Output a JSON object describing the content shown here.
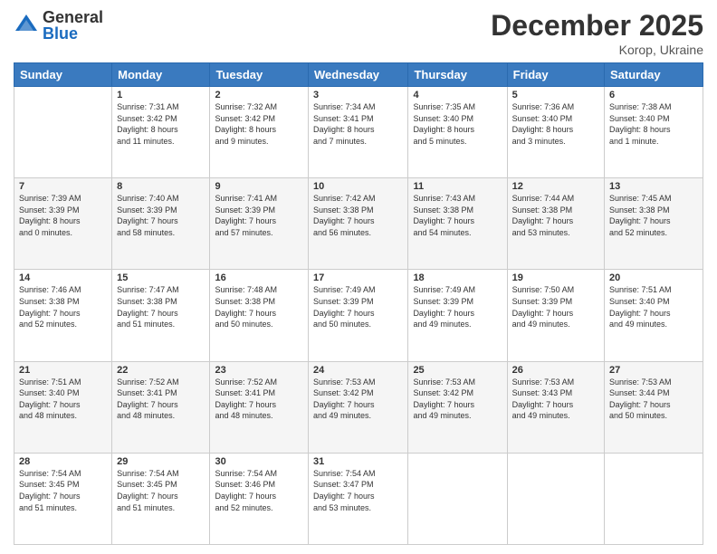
{
  "header": {
    "logo_general": "General",
    "logo_blue": "Blue",
    "month_title": "December 2025",
    "location": "Korop, Ukraine"
  },
  "days_of_week": [
    "Sunday",
    "Monday",
    "Tuesday",
    "Wednesday",
    "Thursday",
    "Friday",
    "Saturday"
  ],
  "weeks": [
    [
      {
        "day": "",
        "info": ""
      },
      {
        "day": "1",
        "info": "Sunrise: 7:31 AM\nSunset: 3:42 PM\nDaylight: 8 hours\nand 11 minutes."
      },
      {
        "day": "2",
        "info": "Sunrise: 7:32 AM\nSunset: 3:42 PM\nDaylight: 8 hours\nand 9 minutes."
      },
      {
        "day": "3",
        "info": "Sunrise: 7:34 AM\nSunset: 3:41 PM\nDaylight: 8 hours\nand 7 minutes."
      },
      {
        "day": "4",
        "info": "Sunrise: 7:35 AM\nSunset: 3:40 PM\nDaylight: 8 hours\nand 5 minutes."
      },
      {
        "day": "5",
        "info": "Sunrise: 7:36 AM\nSunset: 3:40 PM\nDaylight: 8 hours\nand 3 minutes."
      },
      {
        "day": "6",
        "info": "Sunrise: 7:38 AM\nSunset: 3:40 PM\nDaylight: 8 hours\nand 1 minute."
      }
    ],
    [
      {
        "day": "7",
        "info": "Sunrise: 7:39 AM\nSunset: 3:39 PM\nDaylight: 8 hours\nand 0 minutes."
      },
      {
        "day": "8",
        "info": "Sunrise: 7:40 AM\nSunset: 3:39 PM\nDaylight: 7 hours\nand 58 minutes."
      },
      {
        "day": "9",
        "info": "Sunrise: 7:41 AM\nSunset: 3:39 PM\nDaylight: 7 hours\nand 57 minutes."
      },
      {
        "day": "10",
        "info": "Sunrise: 7:42 AM\nSunset: 3:38 PM\nDaylight: 7 hours\nand 56 minutes."
      },
      {
        "day": "11",
        "info": "Sunrise: 7:43 AM\nSunset: 3:38 PM\nDaylight: 7 hours\nand 54 minutes."
      },
      {
        "day": "12",
        "info": "Sunrise: 7:44 AM\nSunset: 3:38 PM\nDaylight: 7 hours\nand 53 minutes."
      },
      {
        "day": "13",
        "info": "Sunrise: 7:45 AM\nSunset: 3:38 PM\nDaylight: 7 hours\nand 52 minutes."
      }
    ],
    [
      {
        "day": "14",
        "info": "Sunrise: 7:46 AM\nSunset: 3:38 PM\nDaylight: 7 hours\nand 52 minutes."
      },
      {
        "day": "15",
        "info": "Sunrise: 7:47 AM\nSunset: 3:38 PM\nDaylight: 7 hours\nand 51 minutes."
      },
      {
        "day": "16",
        "info": "Sunrise: 7:48 AM\nSunset: 3:38 PM\nDaylight: 7 hours\nand 50 minutes."
      },
      {
        "day": "17",
        "info": "Sunrise: 7:49 AM\nSunset: 3:39 PM\nDaylight: 7 hours\nand 50 minutes."
      },
      {
        "day": "18",
        "info": "Sunrise: 7:49 AM\nSunset: 3:39 PM\nDaylight: 7 hours\nand 49 minutes."
      },
      {
        "day": "19",
        "info": "Sunrise: 7:50 AM\nSunset: 3:39 PM\nDaylight: 7 hours\nand 49 minutes."
      },
      {
        "day": "20",
        "info": "Sunrise: 7:51 AM\nSunset: 3:40 PM\nDaylight: 7 hours\nand 49 minutes."
      }
    ],
    [
      {
        "day": "21",
        "info": "Sunrise: 7:51 AM\nSunset: 3:40 PM\nDaylight: 7 hours\nand 48 minutes."
      },
      {
        "day": "22",
        "info": "Sunrise: 7:52 AM\nSunset: 3:41 PM\nDaylight: 7 hours\nand 48 minutes."
      },
      {
        "day": "23",
        "info": "Sunrise: 7:52 AM\nSunset: 3:41 PM\nDaylight: 7 hours\nand 48 minutes."
      },
      {
        "day": "24",
        "info": "Sunrise: 7:53 AM\nSunset: 3:42 PM\nDaylight: 7 hours\nand 49 minutes."
      },
      {
        "day": "25",
        "info": "Sunrise: 7:53 AM\nSunset: 3:42 PM\nDaylight: 7 hours\nand 49 minutes."
      },
      {
        "day": "26",
        "info": "Sunrise: 7:53 AM\nSunset: 3:43 PM\nDaylight: 7 hours\nand 49 minutes."
      },
      {
        "day": "27",
        "info": "Sunrise: 7:53 AM\nSunset: 3:44 PM\nDaylight: 7 hours\nand 50 minutes."
      }
    ],
    [
      {
        "day": "28",
        "info": "Sunrise: 7:54 AM\nSunset: 3:45 PM\nDaylight: 7 hours\nand 51 minutes."
      },
      {
        "day": "29",
        "info": "Sunrise: 7:54 AM\nSunset: 3:45 PM\nDaylight: 7 hours\nand 51 minutes."
      },
      {
        "day": "30",
        "info": "Sunrise: 7:54 AM\nSunset: 3:46 PM\nDaylight: 7 hours\nand 52 minutes."
      },
      {
        "day": "31",
        "info": "Sunrise: 7:54 AM\nSunset: 3:47 PM\nDaylight: 7 hours\nand 53 minutes."
      },
      {
        "day": "",
        "info": ""
      },
      {
        "day": "",
        "info": ""
      },
      {
        "day": "",
        "info": ""
      }
    ]
  ]
}
